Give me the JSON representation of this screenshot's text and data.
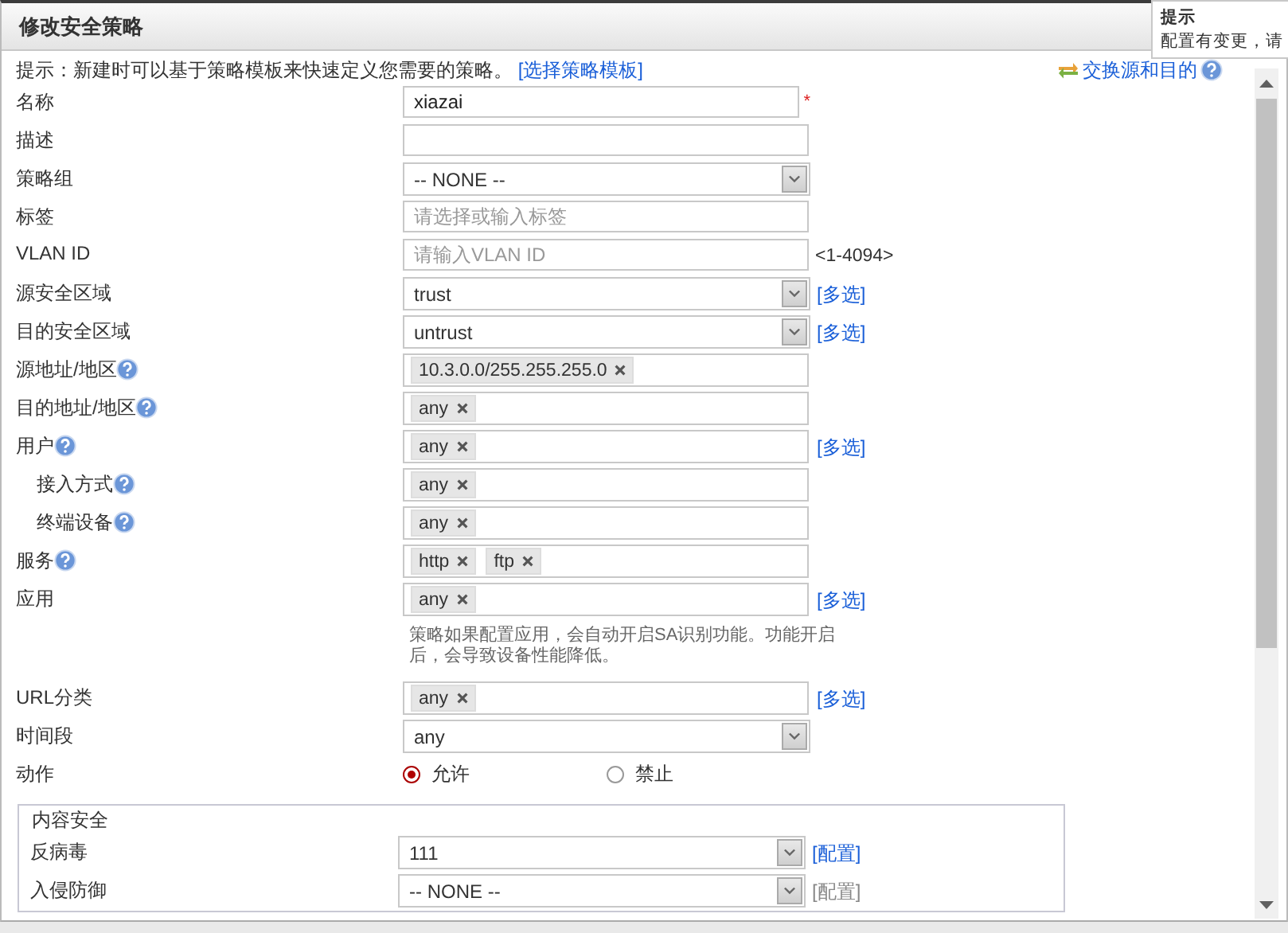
{
  "dialog": {
    "title": "修改安全策略"
  },
  "tooltip": {
    "title": "提示",
    "text": "配置有变更，请"
  },
  "hint": {
    "text": "提示：新建时可以基于策略模板来快速定义您需要的策略。",
    "link": "[选择策略模板]"
  },
  "swap_link": {
    "label": "交换源和目的",
    "help": true
  },
  "fields": [
    {
      "kind": "text",
      "label": "名称",
      "value": "xiazai",
      "required_mark": "*"
    },
    {
      "kind": "text",
      "label": "描述"
    },
    {
      "kind": "select",
      "label": "策略组",
      "value": "-- NONE --"
    },
    {
      "kind": "text",
      "label": "标签",
      "placeholder": "请选择或输入标签"
    },
    {
      "kind": "text",
      "label": "VLAN ID",
      "placeholder": "请输入VLAN ID",
      "suffix": "<1-4094>"
    },
    {
      "kind": "select",
      "label": "源安全区域",
      "value": "trust",
      "link": {
        "label": "[多选]",
        "disabled": false
      }
    },
    {
      "kind": "select",
      "label": "目的安全区域",
      "value": "untrust",
      "link": {
        "label": "[多选]",
        "disabled": false
      }
    },
    {
      "kind": "tags",
      "label": "源地址/地区",
      "help": true,
      "tags": [
        "10.3.0.0/255.255.255.0"
      ]
    },
    {
      "kind": "tags",
      "label": "目的地址/地区",
      "help": true,
      "tags": [
        "any"
      ]
    },
    {
      "kind": "tags",
      "label": "用户",
      "help": true,
      "tags": [
        "any"
      ],
      "link": {
        "label": "[多选]",
        "disabled": false
      },
      "children": [
        {
          "kind": "tags",
          "label": "接入方式",
          "help": true,
          "tags": [
            "any"
          ]
        },
        {
          "kind": "tags",
          "label": "终端设备",
          "help": true,
          "tags": [
            "any"
          ]
        }
      ]
    },
    {
      "kind": "tags",
      "label": "服务",
      "help": true,
      "tags": [
        "http",
        "ftp"
      ]
    },
    {
      "kind": "tags",
      "label": "应用",
      "tags": [
        "any"
      ],
      "link": {
        "label": "[多选]",
        "disabled": false
      },
      "note": "策略如果配置应用，会自动开启SA识别功能。功能开启后，会导致设备性能降低。"
    },
    {
      "kind": "tags",
      "label": "URL分类",
      "tags": [
        "any"
      ],
      "link": {
        "label": "[多选]",
        "disabled": false
      }
    },
    {
      "kind": "select",
      "label": "时间段",
      "value": "any"
    },
    {
      "kind": "radio",
      "label": "动作",
      "options": [
        {
          "label": "允许",
          "selected": true
        },
        {
          "label": "禁止",
          "selected": false
        }
      ]
    }
  ],
  "content_security": {
    "legend": "内容安全",
    "fields": [
      {
        "kind": "select",
        "label": "反病毒",
        "value": "111",
        "link": {
          "label": "[配置]",
          "disabled": false
        }
      },
      {
        "kind": "select",
        "label": "入侵防御",
        "value": "-- NONE --",
        "link": {
          "label": "[配置]",
          "disabled": true
        }
      }
    ]
  }
}
